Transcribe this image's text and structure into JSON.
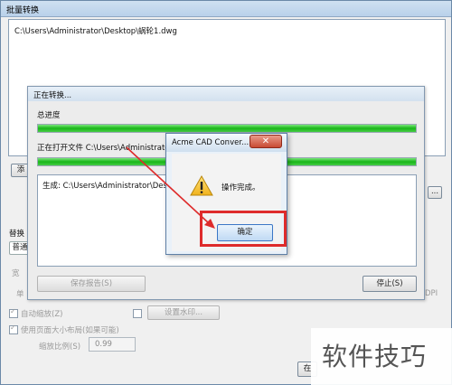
{
  "outer_window": {
    "title": "批量转换",
    "file_path": "C:\\Users\\Administrator\\Desktop\\蜗轮1.dwg",
    "partial_labels": {
      "add_button": "添",
      "replace_section": "替换",
      "replace_value": "普通",
      "more_button": "...",
      "dpi_label": "DPI"
    },
    "auto_zoom_label": "自动缩放(Z)",
    "set_watermark_button": "设置水印...",
    "page_size_label": "使用页面大小布局(如果可能)",
    "scale_label": "缩放比例(S)",
    "scale_value": "0.99",
    "partial_bottom_button": "在"
  },
  "progress_dialog": {
    "title": "正在转换...",
    "total_label": "总进度",
    "total_progress": 100,
    "opening_label": "正在打开文件 C:\\Users\\Administrator",
    "file_progress": 100,
    "log_line": "生成: C:\\Users\\Administrator\\Deskt",
    "save_report_button": "保存报告(S)",
    "stop_button": "停止(S)"
  },
  "message_box": {
    "title": "Acme CAD Conver...",
    "close_icon_glyph": "✕",
    "message": "操作完成。",
    "ok_button": "确定"
  },
  "watermark": {
    "text": "软件技巧"
  },
  "colors": {
    "highlight": "#de2b2b",
    "progress_green": "#19b619"
  }
}
